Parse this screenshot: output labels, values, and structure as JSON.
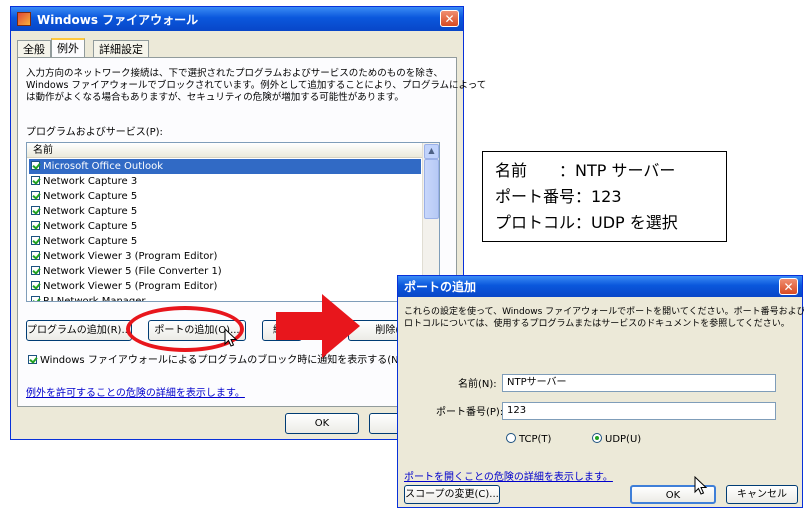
{
  "firewall": {
    "title": "Windows ファイアウォール",
    "close": "✕",
    "tabs": [
      "全般",
      "例外",
      "詳細設定"
    ],
    "description_lines": [
      "入力方向のネットワーク接続は、下で選択されたプログラムおよびサービスのためのものを除き、",
      "Windows ファイアウォールでブロックされています。例外として追加することにより、プログラムによって",
      "は動作がよくなる場合もありますが、セキュリティの危険が増加する可能性があります。"
    ],
    "programs_label": "プログラムおよびサービス(P):",
    "column_header": "名前",
    "programs": [
      {
        "name": "Microsoft Office Outlook",
        "selected": true
      },
      {
        "name": "Network Capture 3",
        "selected": false
      },
      {
        "name": "Network Capture 5",
        "selected": false
      },
      {
        "name": "Network Capture 5",
        "selected": false
      },
      {
        "name": "Network Capture 5",
        "selected": false
      },
      {
        "name": "Network Capture 5",
        "selected": false
      },
      {
        "name": "Network Viewer 3 (Program Editor)",
        "selected": false
      },
      {
        "name": "Network Viewer 5 (File Converter 1)",
        "selected": false
      },
      {
        "name": "Network Viewer 5 (Program Editor)",
        "selected": false
      },
      {
        "name": "P.I Network Manager",
        "selected": false
      }
    ],
    "buttons": {
      "add_program": "プログラムの追加(R)...",
      "add_port": "ポートの追加(O)...",
      "edit": "編集(",
      "delete": "削除(D"
    },
    "notify_checkbox": "Windows ファイアウォールによるプログラムのブロック時に通知を表示する(N)",
    "risk_link": "例外を許可することの危険の詳細を表示します。",
    "ok": "OK",
    "cancel_partial": "キ"
  },
  "callout": {
    "lines": [
      "名前　　：NTP サーバー",
      "ポート番号：123",
      "プロトコル：UDP を選択"
    ]
  },
  "add_port": {
    "title": "ポートの追加",
    "close": "✕",
    "description_lines": [
      "これらの設定を使って、Windows ファイアウォールでポートを開いてください。ポート番号およびプ",
      "ロトコルについては、使用するプログラムまたはサービスのドキュメントを参照してください。"
    ],
    "name_label": "名前(N):",
    "name_value": "NTPサーバー",
    "port_label": "ポート番号(P):",
    "port_value": "123",
    "tcp_label": "TCP(T)",
    "udp_label": "UDP(U)",
    "protocol_selected": "UDP",
    "risk_link": "ポートを開くことの危険の詳細を表示します。",
    "scope_button": "スコープの変更(C)...",
    "ok": "OK",
    "cancel": "キャンセル"
  },
  "colors": {
    "highlight_ring": "#e8161c",
    "arrow": "#e8161c",
    "xp_title": "#0a57dc",
    "selection": "#316ac5"
  }
}
